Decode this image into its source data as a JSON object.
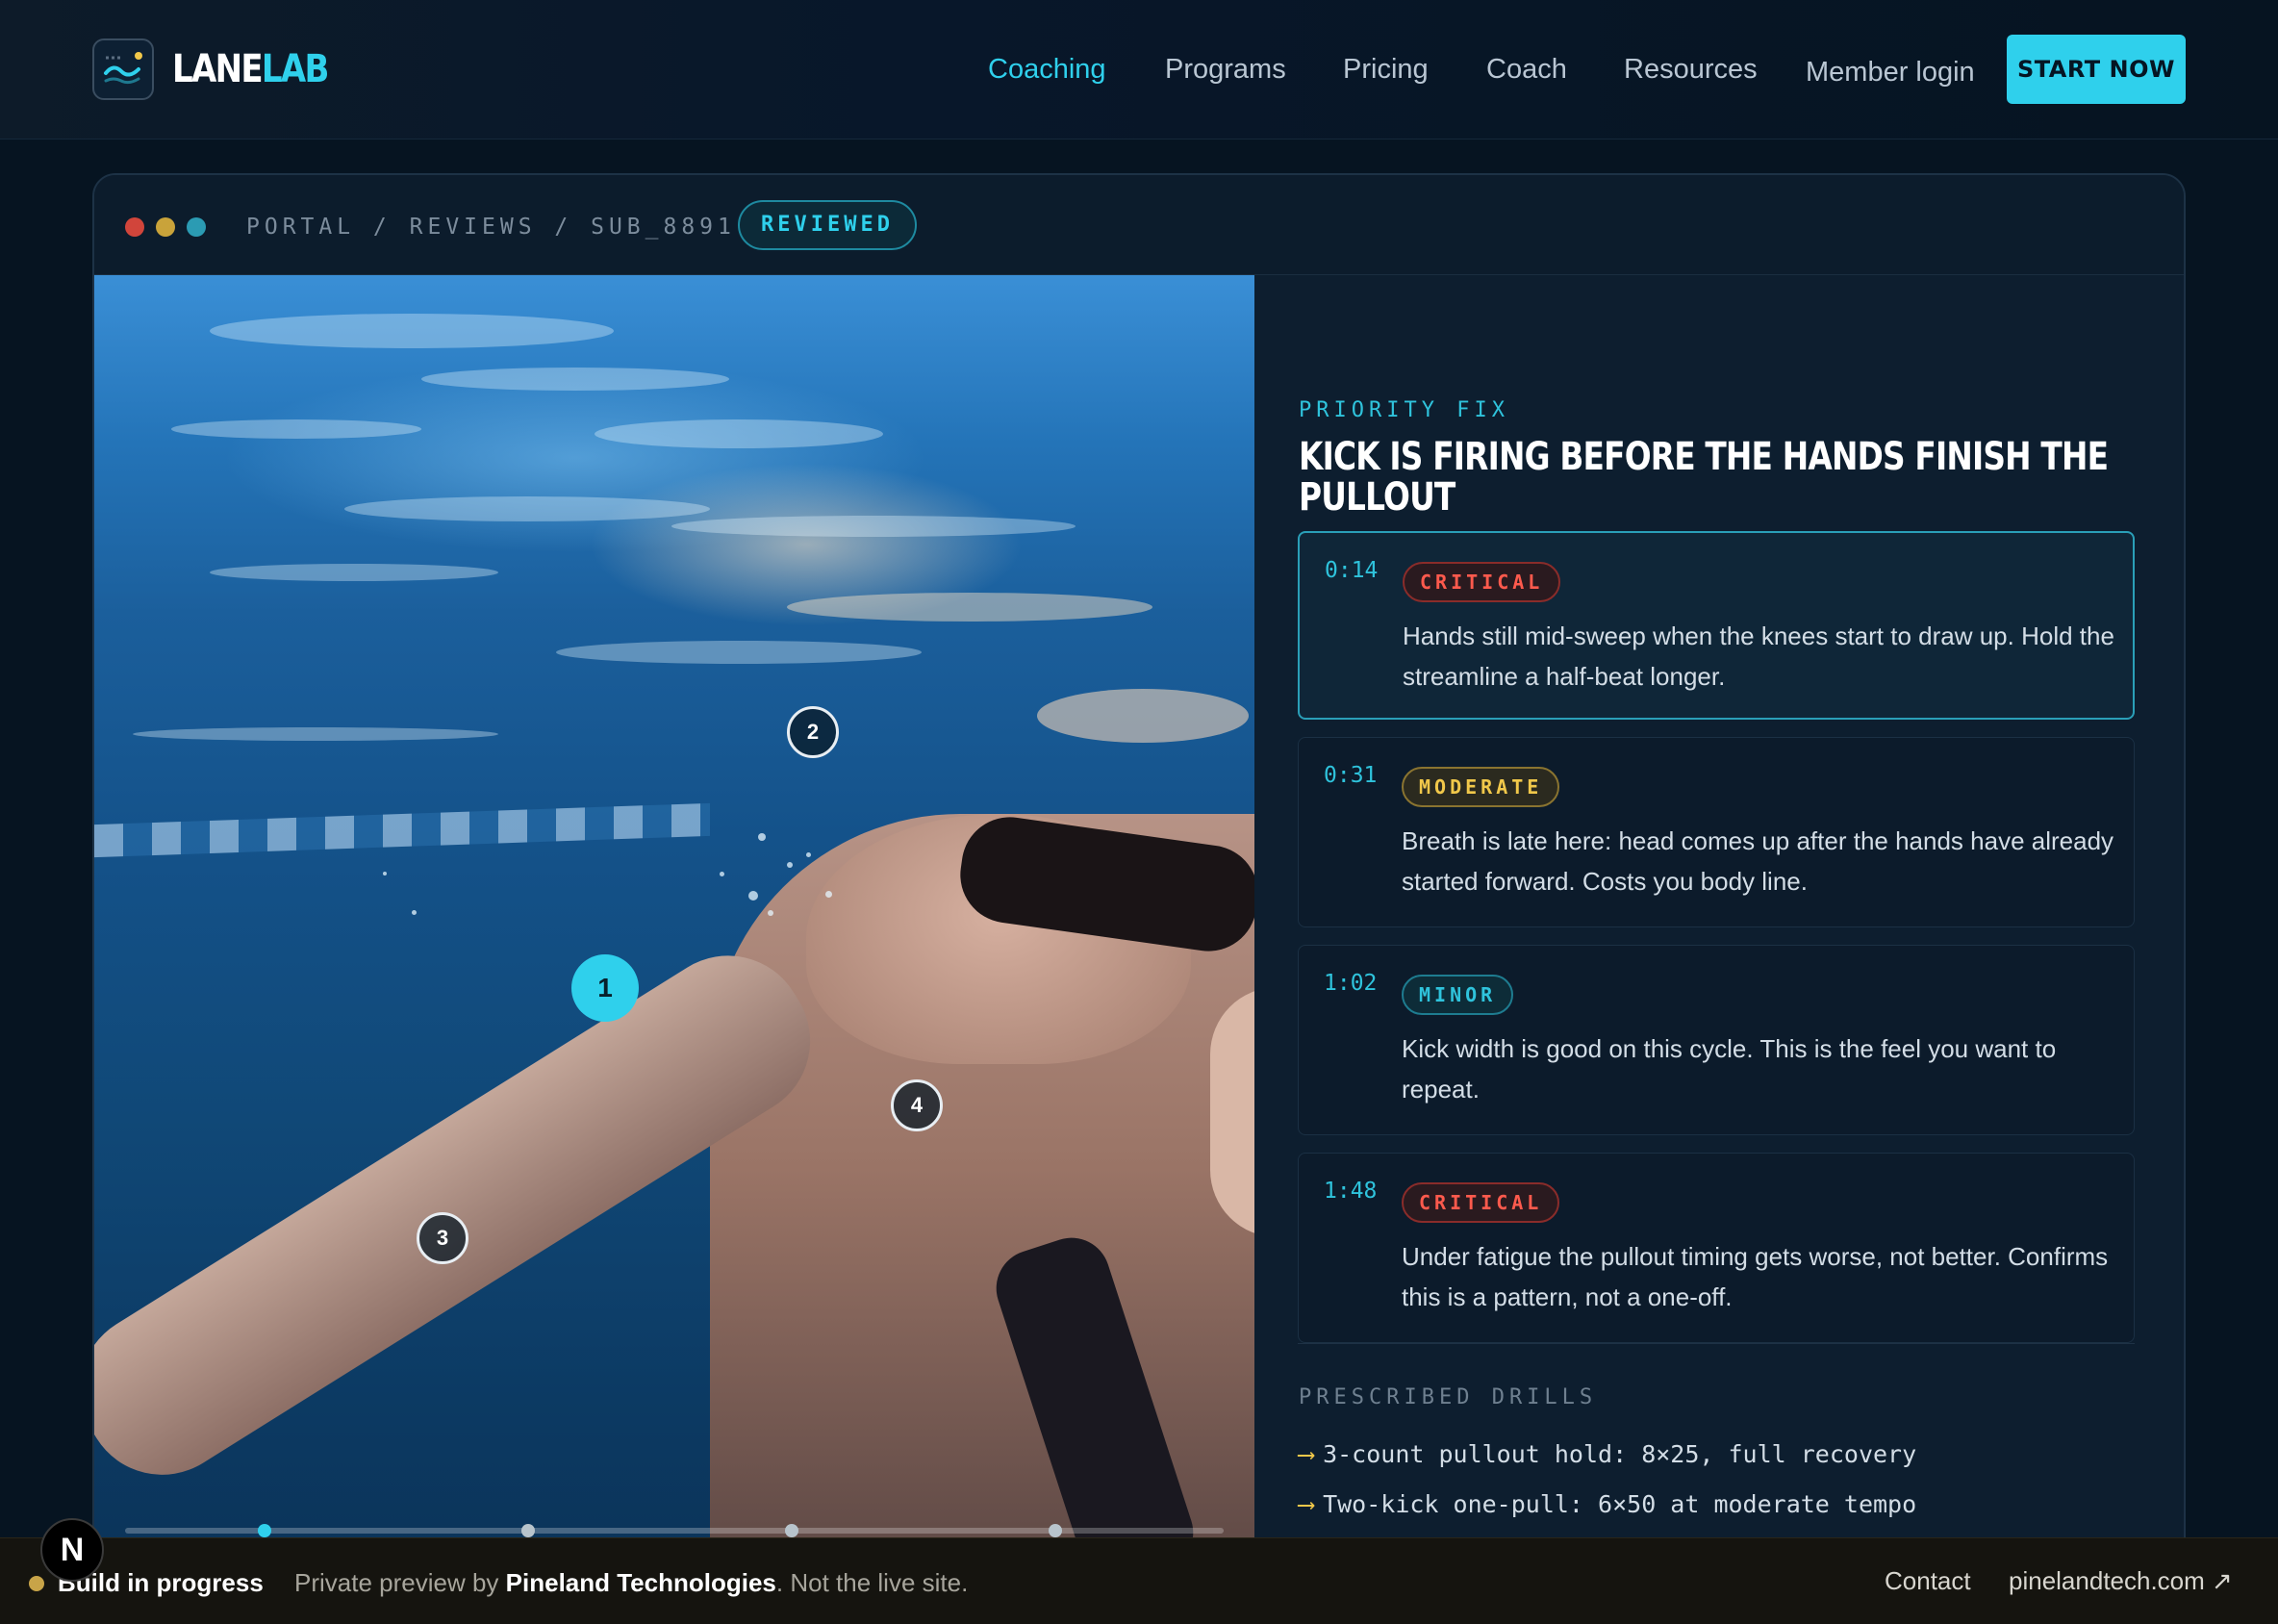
{
  "brand": {
    "name_part1": "LANE",
    "name_part2": "LAB",
    "accent_color": "#2fd0ec"
  },
  "nav": {
    "items": [
      {
        "label": "Coaching",
        "active": true
      },
      {
        "label": "Programs",
        "active": false
      },
      {
        "label": "Pricing",
        "active": false
      },
      {
        "label": "Coach",
        "active": false
      },
      {
        "label": "Resources",
        "active": false
      }
    ],
    "login_label": "Member login",
    "cta_label": "START NOW"
  },
  "panel": {
    "breadcrumb": "PORTAL / REVIEWS / SUB_8891",
    "status": "REVIEWED",
    "window_dots": [
      "#d1453b",
      "#c9a33a",
      "#2b9bb3"
    ]
  },
  "video": {
    "markers": [
      {
        "label": "1",
        "active": true
      },
      {
        "label": "2",
        "active": false
      },
      {
        "label": "3",
        "active": false
      },
      {
        "label": "4",
        "active": false
      }
    ],
    "timeline_active_index": 0
  },
  "review": {
    "eyebrow": "PRIORITY FIX",
    "headline": "KICK IS FIRING BEFORE THE HANDS FINISH THE PULLOUT",
    "notes": [
      {
        "time": "0:14",
        "severity": "CRITICAL",
        "severity_level": "critical",
        "text": "Hands still mid-sweep when the knees start to draw up. Hold the streamline a half-beat longer."
      },
      {
        "time": "0:31",
        "severity": "MODERATE",
        "severity_level": "moderate",
        "text": "Breath is late here: head comes up after the hands have already started forward. Costs you body line."
      },
      {
        "time": "1:02",
        "severity": "MINOR",
        "severity_level": "minor",
        "text": "Kick width is good on this cycle. This is the feel you want to repeat."
      },
      {
        "time": "1:48",
        "severity": "CRITICAL",
        "severity_level": "critical",
        "text": "Under fatigue the pullout timing gets worse, not better. Confirms this is a pattern, not a one-off."
      }
    ],
    "drills_label": "PRESCRIBED DRILLS",
    "drills": [
      "3-count pullout hold: 8×25, full recovery",
      "Two-kick one-pull: 6×50 at moderate tempo"
    ],
    "drill_arrow": "⟶"
  },
  "footer": {
    "build_label": "Build in progress",
    "preview_prefix": "Private preview by ",
    "company": "Pineland Technologies",
    "preview_suffix": ". Not the live site.",
    "contact_label": "Contact",
    "site_label": "pinelandtech.com ↗",
    "badge_letter": "N"
  }
}
